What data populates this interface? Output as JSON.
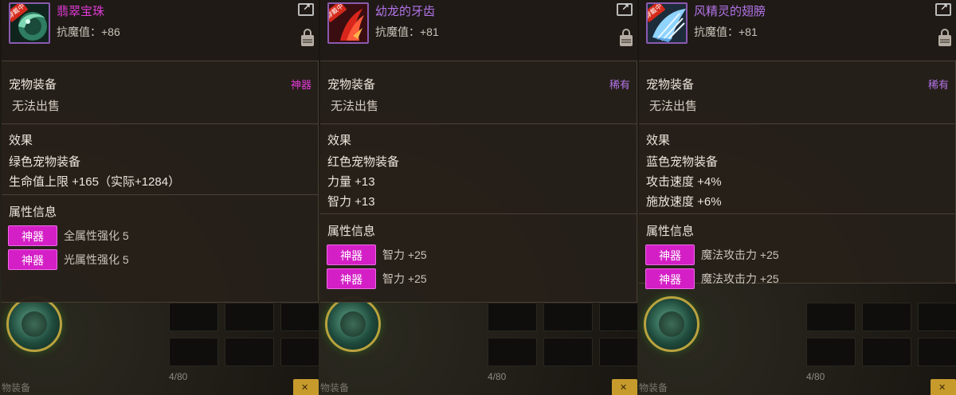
{
  "colors": {
    "rare": "#b374e8",
    "divine": "#e13ad6",
    "divine_button": "#d41fc6"
  },
  "background": {
    "inventory_count": "4/80",
    "bag_label": "物装备"
  },
  "panels": [
    {
      "tag": "穿戴中",
      "icon": "red-dragon-fang-icon",
      "name": "幼龙的牙齿",
      "name_color": "#b374e8",
      "resist": "抗魔值：+81",
      "category": "宠物装备",
      "rarity": "稀有",
      "rarity_color": "#b374e8",
      "sell_note": "无法出售",
      "effect_title": "效果",
      "effects": [
        "红色宠物装备",
        "力量 +13",
        "智力 +13"
      ],
      "attr_title": "属性信息",
      "attrs": [
        {
          "badge": "神器",
          "text": "智力 +25"
        },
        {
          "badge": "神器",
          "text": "智力 +25"
        }
      ]
    },
    {
      "tag": "穿戴中",
      "icon": "blue-wing-icon",
      "name": "风精灵的翅膀",
      "name_color": "#b374e8",
      "resist": "抗魔值：+81",
      "category": "宠物装备",
      "rarity": "稀有",
      "rarity_color": "#b374e8",
      "sell_note": "无法出售",
      "effect_title": "效果",
      "effects": [
        "蓝色宠物装备",
        "攻击速度 +4%",
        "施放速度 +6%"
      ],
      "attr_title": "属性信息",
      "attrs": [
        {
          "badge": "神器",
          "text": "魔法攻击力 +25"
        },
        {
          "badge": "神器",
          "text": "魔法攻击力 +25"
        }
      ]
    },
    {
      "tag": "穿戴中",
      "icon": "green-jade-orb-icon",
      "name": "翡翠宝珠",
      "name_color": "#e13ad6",
      "resist": "抗魔值：+86",
      "category": "宠物装备",
      "rarity": "神器",
      "rarity_color": "#e13ad6",
      "sell_note": "无法出售",
      "effect_title": "效果",
      "effects": [
        "绿色宠物装备",
        "生命值上限 +165（实际+1284）"
      ],
      "attr_title": "属性信息",
      "attrs": [
        {
          "badge": "神器",
          "text": "全属性强化 5"
        },
        {
          "badge": "神器",
          "text": "光属性强化 5"
        }
      ]
    }
  ]
}
